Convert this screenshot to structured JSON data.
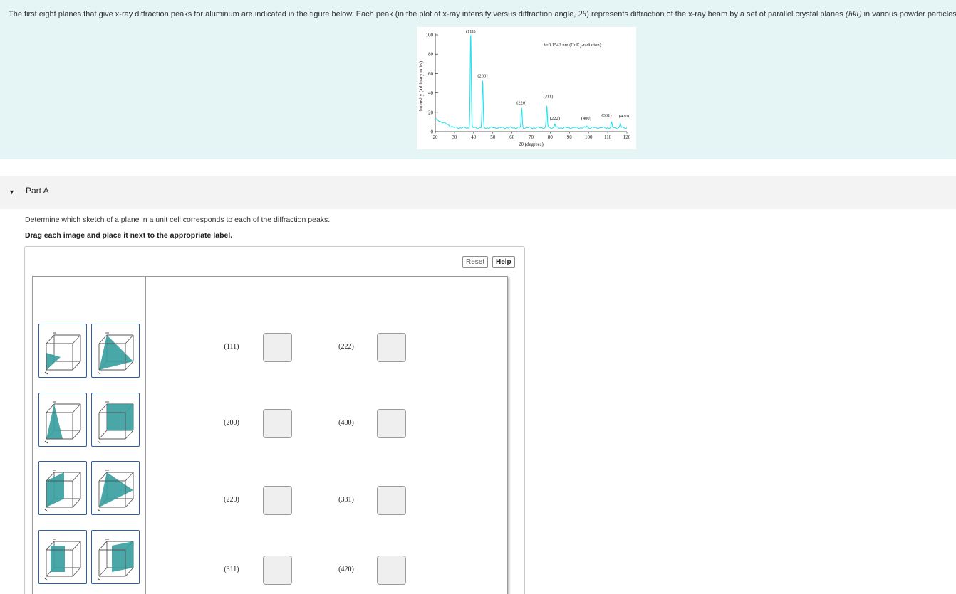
{
  "intro": {
    "text_before_theta": "The first eight planes that give x-ray diffraction peaks for aluminum are indicated in the figure below. Each peak (in the plot of x-ray intensity versus diffraction angle, ",
    "two_theta": "2θ",
    "text_before_hkl": ") represents diffraction of the x-ray beam by a set of parallel crystal planes ",
    "hkl": "(hkl)",
    "text_after_hkl": " in various powder particles."
  },
  "figure": {
    "wavelength_label": "λ=0.1542 nm (CuK",
    "wavelength_sub": "α",
    "wavelength_tail": "-radiation)",
    "line_color": "#22e3ef",
    "chart_data": {
      "type": "line",
      "xlabel": "2θ (degrees)",
      "ylabel": "Intensity (arbitrary units)",
      "xlim": [
        20,
        120
      ],
      "ylim": [
        0,
        100
      ],
      "x_ticks": [
        "20",
        "30",
        "40",
        "50",
        "60",
        "70",
        "80",
        "90",
        "100",
        "110",
        "120"
      ],
      "y_ticks": [
        "0",
        "20",
        "40",
        "60",
        "80",
        "100"
      ],
      "peaks": [
        {
          "label": "(111)",
          "two_theta": 38.5,
          "intensity": 100
        },
        {
          "label": "(200)",
          "two_theta": 44.7,
          "intensity": 52
        },
        {
          "label": "(220)",
          "two_theta": 65.1,
          "intensity": 23
        },
        {
          "label": "(311)",
          "two_theta": 78.2,
          "intensity": 26
        },
        {
          "label": "(222)",
          "two_theta": 82.4,
          "intensity": 8
        },
        {
          "label": "(400)",
          "two_theta": 99.1,
          "intensity": 6
        },
        {
          "label": "(331)",
          "two_theta": 112.0,
          "intensity": 9
        },
        {
          "label": "(420)",
          "two_theta": 116.6,
          "intensity": 8
        }
      ]
    }
  },
  "part_a": {
    "title": "Part A",
    "instruction": "Determine which sketch of a plane in a unit cell corresponds to each of the diffraction peaks.",
    "drag_instruction": "Drag each image and place it next to the appropriate label.",
    "reset_label": "Reset",
    "help_label": "Help",
    "plane_fill": "#3aa0a0",
    "labels": [
      "(111)",
      "(222)",
      "(200)",
      "(400)",
      "(220)",
      "(331)",
      "(311)",
      "(420)"
    ]
  }
}
